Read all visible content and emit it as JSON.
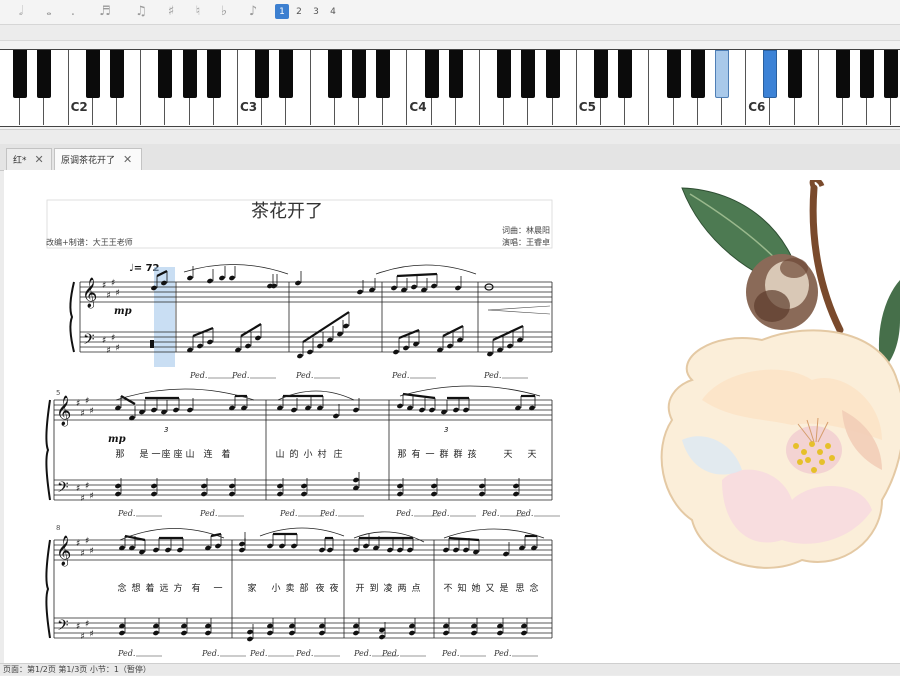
{
  "toolbar": {
    "icons": [
      "half-note-icon",
      "whole-note-icon",
      "dot-icon",
      "sixteenth-notes-icon",
      "triplet-icon",
      "sharp-icon",
      "natural-icon",
      "flat-icon",
      "tie-icon"
    ],
    "pages": [
      "1",
      "2",
      "3",
      "4"
    ],
    "active_page": "1"
  },
  "piano": {
    "octave_labels": [
      "C2",
      "C3",
      "C4",
      "C5",
      "C6"
    ],
    "highlighted_keys": [
      "A#4 (light)",
      "C#5 (active)"
    ]
  },
  "tabs": [
    {
      "label": "红*",
      "close": "✕"
    },
    {
      "label": "原调茶花开了",
      "close": "✕"
    }
  ],
  "score": {
    "title": "茶花开了",
    "lyricist": "词曲：林晨阳",
    "arranger": "改编+制谱：大王王老师",
    "singer": "演唱：王睿卓",
    "tempo": "♩= 72",
    "dynamic": "mp",
    "measure_numbers": [
      "5",
      "8"
    ],
    "pedal": "𝆮",
    "lyrics_line1": [
      "那",
      "是",
      "一",
      "座",
      "座",
      "山",
      "连",
      "着",
      "山",
      "的",
      "小",
      "村",
      "庄",
      "那",
      "有",
      "一",
      "群",
      "群",
      "孩",
      "天",
      "天"
    ],
    "lyrics_line2": [
      "念",
      "想",
      "着",
      "远",
      "方",
      "有",
      "一",
      "家",
      "小",
      "卖",
      "部",
      "夜",
      "夜",
      "开",
      "到",
      "凌",
      "两",
      "点",
      "不",
      "知",
      "她",
      "又",
      "是",
      "思",
      "念"
    ]
  },
  "status": {
    "text": "页面：第1/2页 第1/3页 小节：1（暂停）"
  }
}
